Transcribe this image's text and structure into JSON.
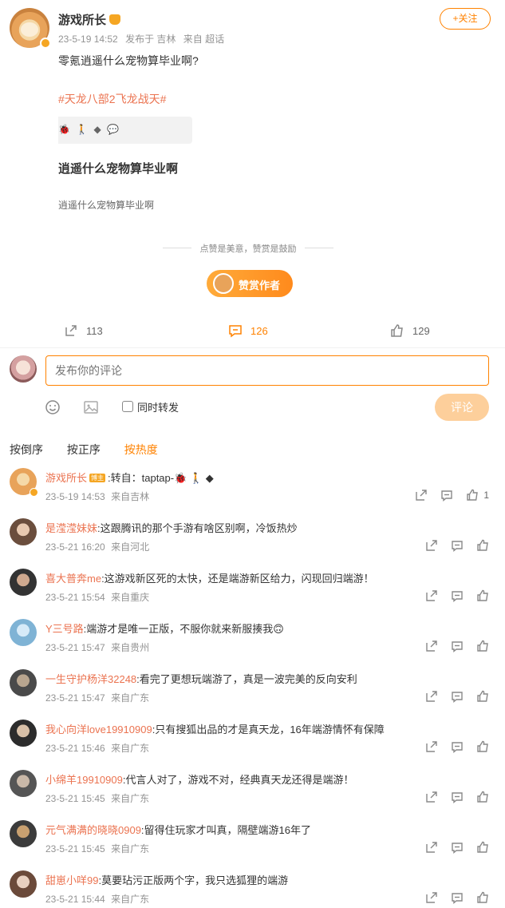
{
  "post": {
    "author": "游戏所长",
    "date": "23-5-19 14:52",
    "location": "发布于 吉林",
    "source": "来自 超话",
    "follow_label": "+关注",
    "text": "零氪逍遥什么宠物算毕业啊?",
    "topic": "#天龙八部2飞龙战天#",
    "strip_icons": "🐞 🚶 ◆ 💬",
    "card_title": "逍遥什么宠物算毕业啊",
    "card_sub": "逍遥什么宠物算毕业啊"
  },
  "reward": {
    "prompt": "点赞是美意，赞赏是鼓励",
    "button_label": "赞赏作者"
  },
  "actions": {
    "repost_count": "113",
    "comment_count": "126",
    "like_count": "129"
  },
  "composer": {
    "placeholder": "发布你的评论",
    "repost_label": "同时转发",
    "submit_label": "评论"
  },
  "sort": {
    "options": [
      "按倒序",
      "按正序",
      "按热度"
    ],
    "active": "按热度"
  },
  "colors": {
    "accent": "#ff8200",
    "name": "#eb7350"
  },
  "comments": [
    {
      "name": "游戏所长",
      "tag": "博主",
      "text": ":转自：taptap-🐞 🚶 ◆",
      "date": "23-5-19 14:53",
      "from": "来自吉林",
      "likes": "1"
    },
    {
      "name": "是滢滢妹妹",
      "text": ":这跟腾讯的那个手游有啥区别啊，冷饭热炒",
      "date": "23-5-21 16:20",
      "from": "来自河北",
      "likes": ""
    },
    {
      "name": "喜大普奔me",
      "text": ":这游戏新区死的太快，还是端游新区给力，闪现回归端游！",
      "date": "23-5-21 15:54",
      "from": "来自重庆",
      "likes": ""
    },
    {
      "name": "Y三号路",
      "text": ":端游才是唯一正版，不服你就来新服揍我🙃",
      "date": "23-5-21 15:47",
      "from": "来自贵州",
      "likes": ""
    },
    {
      "name": "一生守护杨洋32248",
      "text": ":看完了更想玩端游了，真是一波完美的反向安利",
      "date": "23-5-21 15:47",
      "from": "来自广东",
      "likes": ""
    },
    {
      "name": "我心向洋love19910909",
      "text": ":只有搜狐出品的才是真天龙，16年端游情怀有保障",
      "date": "23-5-21 15:46",
      "from": "来自广东",
      "likes": ""
    },
    {
      "name": "小绵羊19910909",
      "text": ":代言人对了，游戏不对，经典真天龙还得是端游！",
      "date": "23-5-21 15:45",
      "from": "来自广东",
      "likes": ""
    },
    {
      "name": "元气满满的晓晓0909",
      "text": ":留得住玩家才叫真，隔壁端游16年了",
      "date": "23-5-21 15:45",
      "from": "来自广东",
      "likes": ""
    },
    {
      "name": "甜崽小咩99",
      "text": ":莫要玷污正版两个字，我只选狐狸的端游",
      "date": "23-5-21 15:44",
      "from": "来自广东",
      "likes": ""
    }
  ]
}
